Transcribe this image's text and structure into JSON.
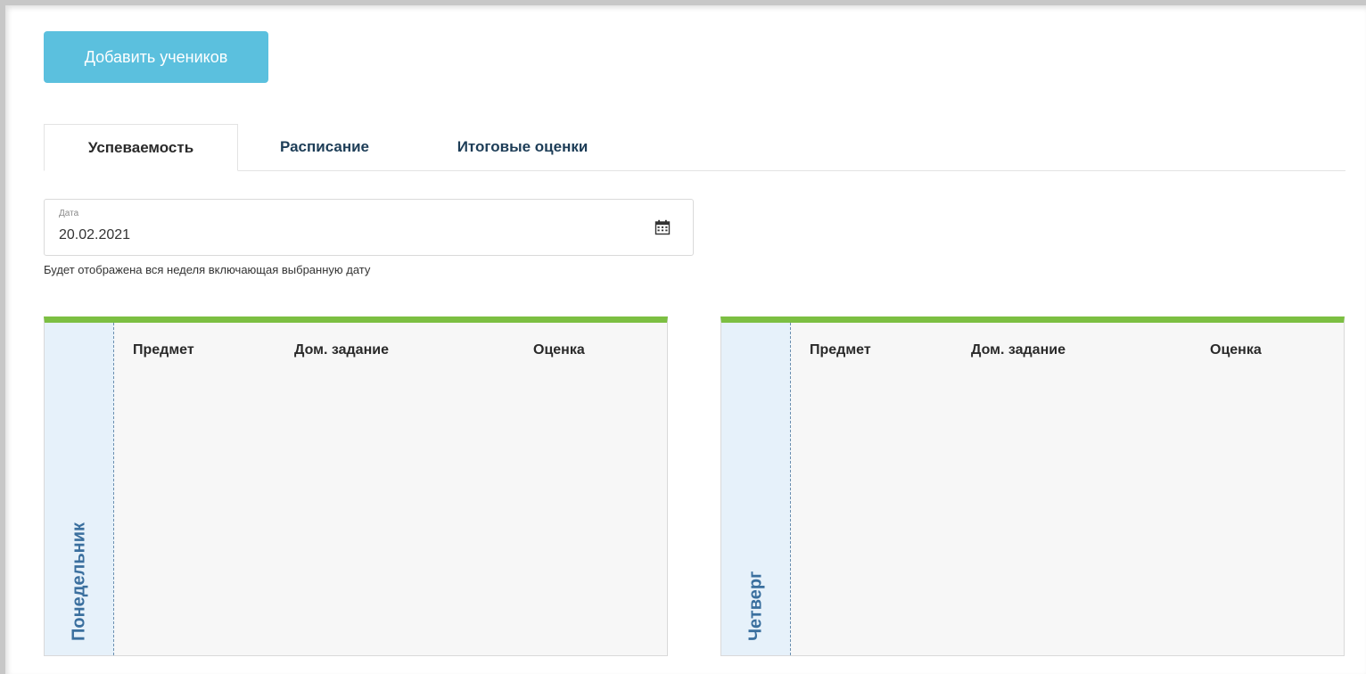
{
  "toolbar": {
    "add_students_label": "Добавить учеников"
  },
  "tabs": [
    {
      "label": "Успеваемость",
      "active": true
    },
    {
      "label": "Расписание",
      "active": false
    },
    {
      "label": "Итоговые оценки",
      "active": false
    }
  ],
  "date_field": {
    "label": "Дата",
    "value": "20.02.2021",
    "hint": "Будет отображена вся неделя включающая выбранную дату"
  },
  "days": [
    {
      "name": "Понедельник",
      "columns": {
        "subject": "Предмет",
        "homework": "Дом. задание",
        "grade": "Оценка"
      }
    },
    {
      "name": "Четверг",
      "columns": {
        "subject": "Предмет",
        "homework": "Дом. задание",
        "grade": "Оценка"
      }
    }
  ],
  "colors": {
    "accent_button": "#5bc0de",
    "day_card_top": "#7cbf42",
    "day_strip": "#e6f1fa",
    "tab_text": "#1d3d57"
  },
  "icons": {
    "calendar": "calendar-icon"
  }
}
